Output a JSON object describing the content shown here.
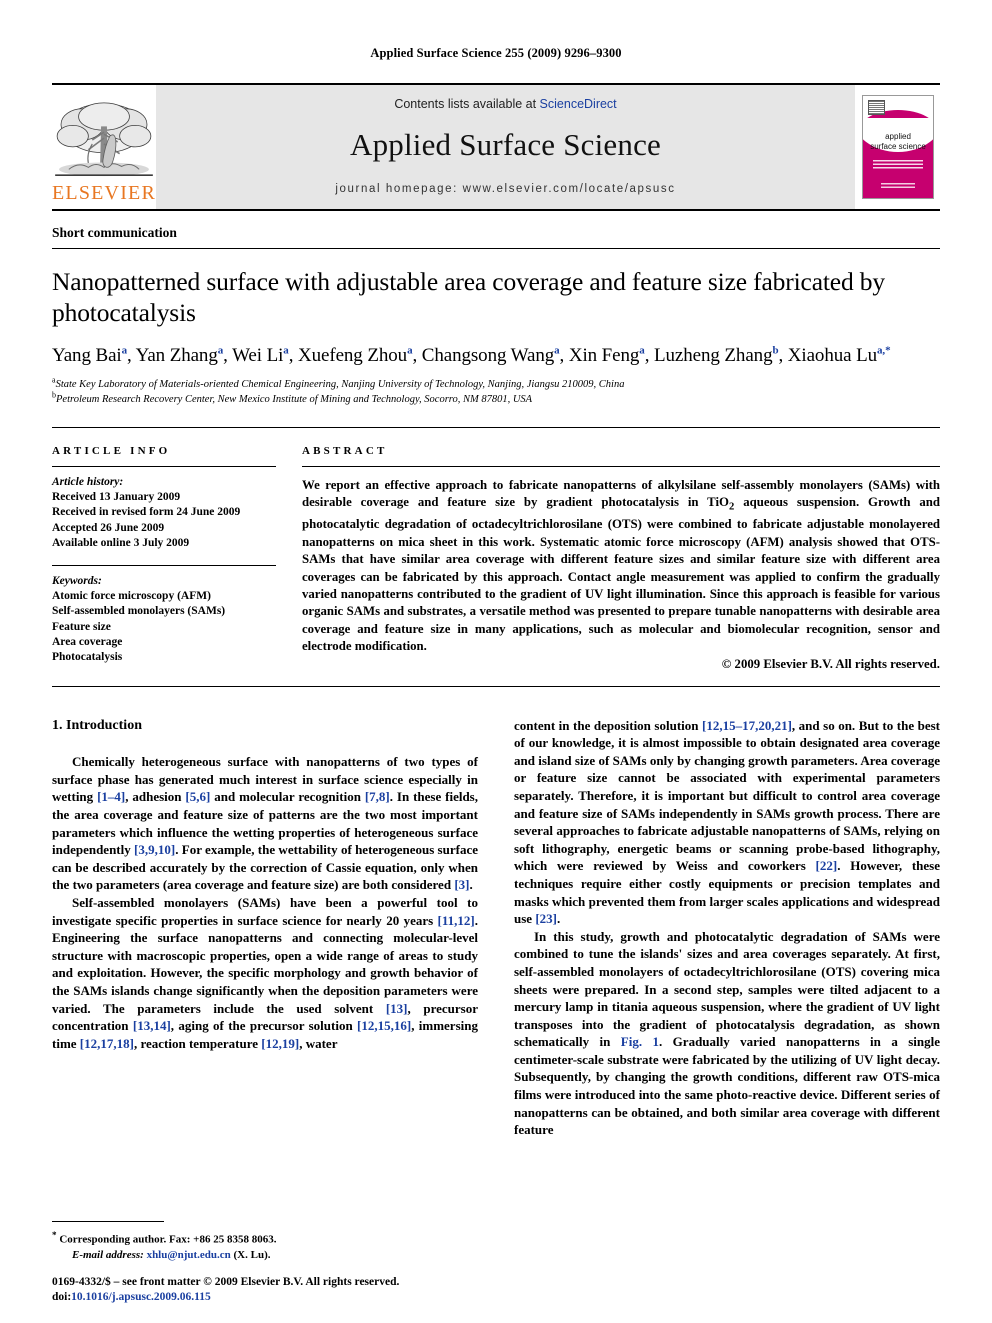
{
  "running_head": "Applied Surface Science 255 (2009) 9296–9300",
  "masthead": {
    "publisher_name": "ELSEVIER",
    "contents_prefix": "Contents lists available at ",
    "contents_link": "ScienceDirect",
    "journal_title": "Applied Surface Science",
    "homepage": "journal homepage: www.elsevier.com/locate/apsusc",
    "cover": {
      "line1": "applied",
      "line2": "surface science"
    }
  },
  "article": {
    "type": "Short communication",
    "title": "Nanopatterned surface with adjustable area coverage and feature size fabricated by photocatalysis",
    "authors_html": "Yang Bai<sup>a</sup>, Yan Zhang<sup>a</sup>, Wei Li<sup>a</sup>, Xuefeng Zhou<sup>a</sup>, Changsong Wang<sup>a</sup>, Xin Feng<sup>a</sup>, Luzheng Zhang<sup>b</sup>, Xiaohua Lu<sup>a,*</sup>",
    "affiliations": [
      "State Key Laboratory of Materials-oriented Chemical Engineering, Nanjing University of Technology, Nanjing, Jiangsu 210009, China",
      "Petroleum Research Recovery Center, New Mexico Institute of Mining and Technology, Socorro, NM 87801, USA"
    ],
    "affiliation_marks": [
      "a",
      "b"
    ]
  },
  "article_info": {
    "heading": "ARTICLE INFO",
    "history_label": "Article history:",
    "history": [
      "Received 13 January 2009",
      "Received in revised form 24 June 2009",
      "Accepted 26 June 2009",
      "Available online 3 July 2009"
    ],
    "keywords_label": "Keywords:",
    "keywords": [
      "Atomic force microscopy (AFM)",
      "Self-assembled monolayers (SAMs)",
      "Feature size",
      "Area coverage",
      "Photocatalysis"
    ]
  },
  "abstract": {
    "heading": "ABSTRACT",
    "text_html": "We report an effective approach to fabricate nanopatterns of alkylsilane self-assembly monolayers (SAMs) with desirable coverage and feature size by gradient photocatalysis in TiO<sub>2</sub> aqueous suspension. Growth and photocatalytic degradation of octadecyltrichlorosilane (OTS) were combined to fabricate adjustable monolayered nanopatterns on mica sheet in this work. Systematic atomic force microscopy (AFM) analysis showed that OTS-SAMs that have similar area coverage with different feature sizes and similar feature size with different area coverages can be fabricated by this approach. Contact angle measurement was applied to confirm the gradually varied nanopatterns contributed to the gradient of UV light illumination. Since this approach is feasible for various organic SAMs and substrates, a versatile method was presented to prepare tunable nanopatterns with desirable area coverage and feature size in many applications, such as molecular and biomolecular recognition, sensor and electrode modification.",
    "copyright": "© 2009 Elsevier B.V. All rights reserved."
  },
  "body": {
    "section_number_title": "1. Introduction",
    "left_paragraphs_html": [
      "Chemically heterogeneous surface with nanopatterns of two types of surface phase has generated much interest in surface science especially in wetting <span class=\"ref\">[1–4]</span>, adhesion <span class=\"ref\">[5,6]</span> and molecular recognition <span class=\"ref\">[7,8]</span>. In these fields, the area coverage and feature size of patterns are the two most important parameters which influence the wetting properties of heterogeneous surface independently <span class=\"ref\">[3,9,10]</span>. For example, the wettability of heterogeneous surface can be described accurately by the correction of Cassie equation, only when the two parameters (area coverage and feature size) are both considered <span class=\"ref\">[3]</span>.",
      "Self-assembled monolayers (SAMs) have been a powerful tool to investigate specific properties in surface science for nearly 20 years <span class=\"ref\">[11,12]</span>. Engineering the surface nanopatterns and connecting molecular-level structure with macroscopic properties, open a wide range of areas to study and exploitation. However, the specific morphology and growth behavior of the SAMs islands change significantly when the deposition parameters were varied. The parameters include the used solvent <span class=\"ref\">[13]</span>, precursor concentration <span class=\"ref\">[13,14]</span>, aging of the precursor solution <span class=\"ref\">[12,15,16]</span>, immersing time <span class=\"ref\">[12,17,18]</span>, reaction temperature <span class=\"ref\">[12,19]</span>, water"
    ],
    "right_paragraphs_html": [
      "content in the deposition solution <span class=\"ref\">[12,15–17,20,21]</span>, and so on. But to the best of our knowledge, it is almost impossible to obtain designated area coverage and island size of SAMs only by changing growth parameters. Area coverage or feature size cannot be associated with experimental parameters separately. Therefore, it is important but difficult to control area coverage and feature size of SAMs independently in SAMs growth process. There are several approaches to fabricate adjustable nanopatterns of SAMs, relying on soft lithography, energetic beams or scanning probe-based lithography, which were reviewed by Weiss and coworkers <span class=\"ref\">[22]</span>. However, these techniques require either costly equipments or precision templates and masks which prevented them from larger scales applications and widespread use <span class=\"ref\">[23]</span>.",
      "In this study, growth and photocatalytic degradation of SAMs were combined to tune the islands' sizes and area coverages separately. At first, self-assembled monolayers of octadecyltrichlorosilane (OTS) covering mica sheets were prepared. In a second step, samples were tilted adjacent to a mercury lamp in titania aqueous suspension, where the gradient of UV light transposes into the gradient of photocatalysis degradation, as shown schematically in <span class=\"link\">Fig. 1</span>. Gradually varied nanopatterns in a single centimeter-scale substrate were fabricated by the utilizing of UV light decay. Subsequently, by changing the growth conditions, different raw OTS-mica films were introduced into the same photo-reactive device. Different series of nanopatterns can be obtained, and both similar area coverage with different feature"
    ]
  },
  "footnote": {
    "corresponding_html": "<sup>*</sup> Corresponding author. Fax: +86 25 8358 8063.",
    "email_html": "<span class=\"it\">E-mail address:</span> <span class=\"link\">xhlu@njut.edu.cn</span> (X. Lu)."
  },
  "footer": {
    "issn_line_html": "0169-4332/$ – see front matter © 2009 Elsevier B.V. All rights reserved.",
    "doi_html": "doi:<span class=\"link\">10.1016/j.apsusc.2009.06.115</span>"
  }
}
